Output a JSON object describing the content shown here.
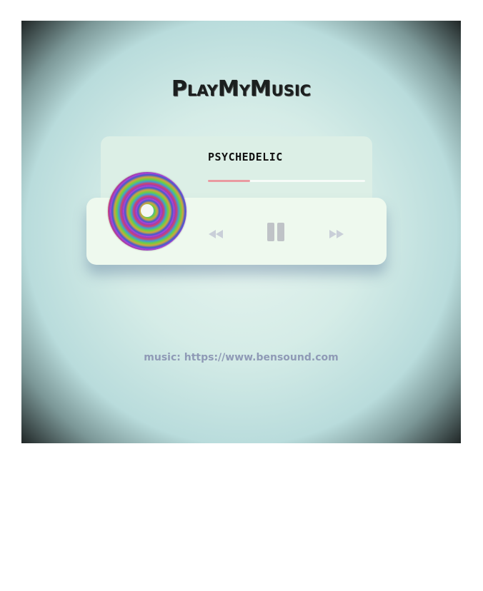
{
  "app": {
    "title": "PlayMyMusic"
  },
  "player": {
    "song_title": "PSYCHEDELIC",
    "progress_fraction": 0.27,
    "state": "playing",
    "accent_color": "#e99aa1",
    "controls": {
      "prev_icon": "rewind-icon",
      "pause_icon": "pause-icon",
      "next_icon": "fast-forward-icon"
    }
  },
  "footer": {
    "credit": "music: https://www.bensound.com"
  }
}
